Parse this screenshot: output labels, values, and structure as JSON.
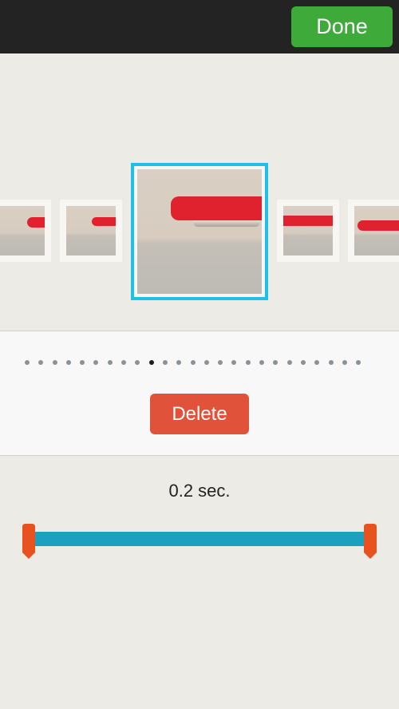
{
  "toolbar": {
    "done_label": "Done"
  },
  "frames": {
    "total": 25,
    "selected_index": 9
  },
  "actions": {
    "delete_label": "Delete"
  },
  "duration": {
    "label": "0.2 sec.",
    "range_start_fraction": 0,
    "range_end_fraction": 1
  },
  "colors": {
    "done": "#3daa3a",
    "delete": "#e0533a",
    "selection": "#1fc0e6",
    "track": "#1ca0bf",
    "handle": "#e8521f"
  }
}
